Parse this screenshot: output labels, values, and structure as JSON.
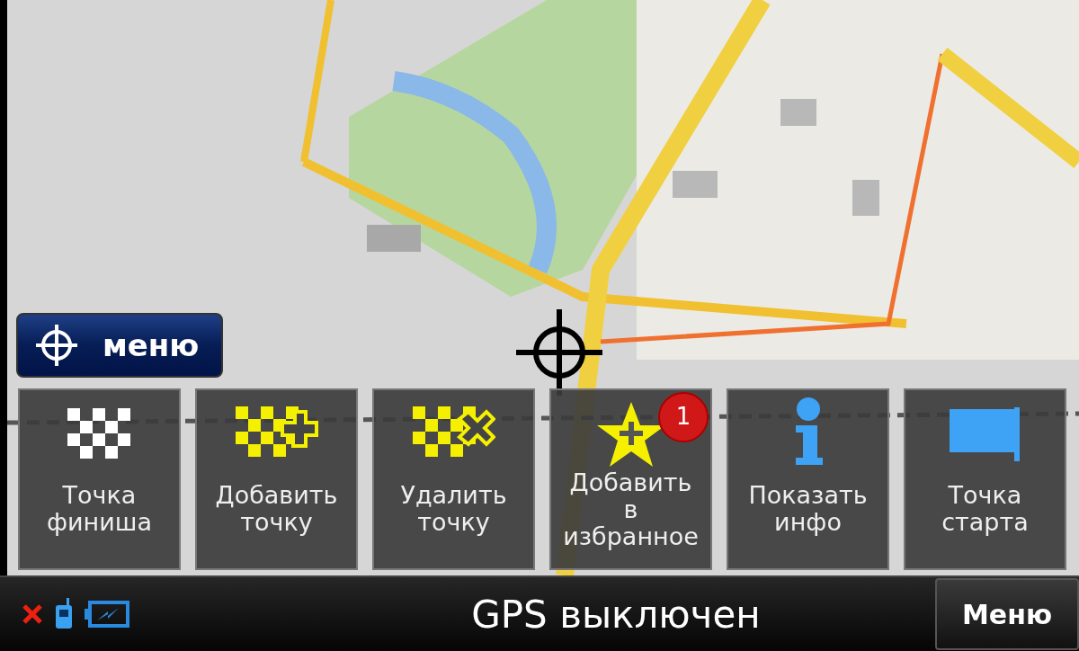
{
  "map_menu_button": {
    "label": "меню"
  },
  "actions": [
    {
      "kind": "finish",
      "lines": [
        "Точка",
        "финиша"
      ]
    },
    {
      "kind": "add_point",
      "lines": [
        "Добавить",
        "точку"
      ]
    },
    {
      "kind": "remove_point",
      "lines": [
        "Удалить",
        "точку"
      ]
    },
    {
      "kind": "favorite",
      "lines": [
        "Добавить",
        "в",
        "избранное"
      ],
      "badge": "1"
    },
    {
      "kind": "info",
      "lines": [
        "Показать",
        "инфо"
      ]
    },
    {
      "kind": "start",
      "lines": [
        "Точка",
        "старта"
      ]
    }
  ],
  "status_bar": {
    "title": "GPS выключен",
    "menu_button": "Меню"
  }
}
